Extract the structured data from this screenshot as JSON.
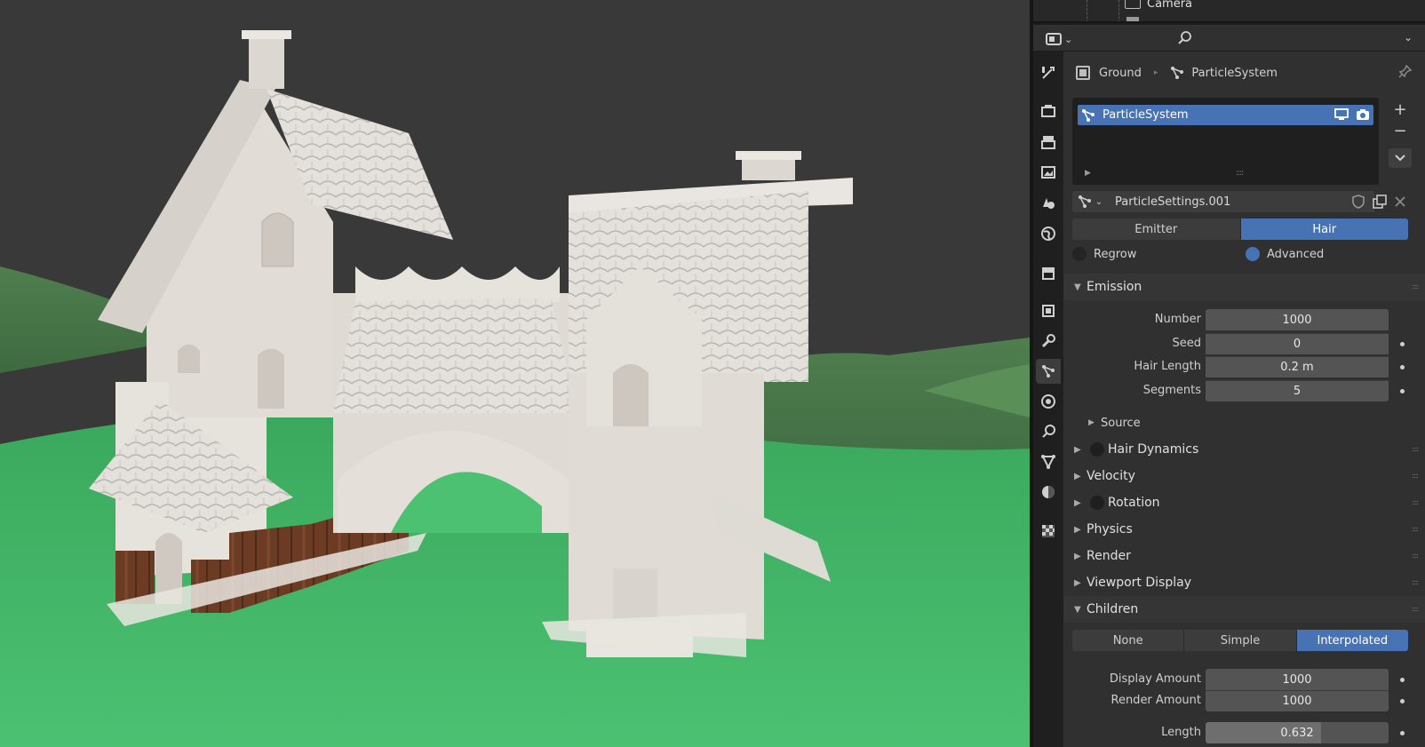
{
  "outliner": {
    "camera_label": "Camera"
  },
  "breadcrumb": {
    "object": "Ground",
    "system": "ParticleSystem"
  },
  "ps_list": {
    "items": [
      {
        "label": "ParticleSystem",
        "selected": true
      }
    ]
  },
  "settings": {
    "name": "ParticleSettings.001"
  },
  "type_toggle": {
    "options": [
      "Emitter",
      "Hair"
    ],
    "selected": "Hair"
  },
  "regrow": {
    "label": "Regrow",
    "checked": false
  },
  "advanced": {
    "label": "Advanced",
    "checked": true
  },
  "emission": {
    "title": "Emission",
    "expanded": true,
    "fields": [
      {
        "label": "Number",
        "value": "1000",
        "animatable": false
      },
      {
        "label": "Seed",
        "value": "0",
        "animatable": true
      },
      {
        "label": "Hair Length",
        "value": "0.2 m",
        "animatable": true
      },
      {
        "label": "Segments",
        "value": "5",
        "animatable": true
      }
    ],
    "source": "Source"
  },
  "panels": [
    {
      "title": "Hair Dynamics",
      "has_checkbox": true,
      "expanded": false
    },
    {
      "title": "Velocity",
      "has_checkbox": false,
      "expanded": false
    },
    {
      "title": "Rotation",
      "has_checkbox": true,
      "expanded": false
    },
    {
      "title": "Physics",
      "has_checkbox": false,
      "expanded": false
    },
    {
      "title": "Render",
      "has_checkbox": false,
      "expanded": false
    },
    {
      "title": "Viewport Display",
      "has_checkbox": false,
      "expanded": false
    }
  ],
  "children": {
    "title": "Children",
    "expanded": true,
    "modes": [
      "None",
      "Simple",
      "Interpolated"
    ],
    "selected_mode": "Interpolated",
    "display_amount": {
      "label": "Display Amount",
      "value": "1000"
    },
    "render_amount": {
      "label": "Render Amount",
      "value": "1000"
    },
    "length": {
      "label": "Length",
      "value": "0.632",
      "fraction": 0.632
    }
  },
  "colors": {
    "accent": "#4772b3",
    "panel_bg": "#303030",
    "field_bg": "#545454",
    "grass": "#3fb366",
    "sky": "#3a3a3a"
  }
}
